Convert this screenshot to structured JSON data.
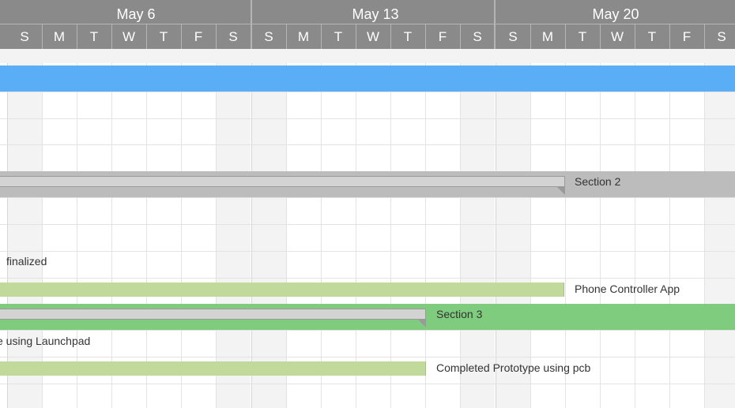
{
  "timeline": {
    "weeks": [
      {
        "label": "May 6"
      },
      {
        "label": "May 13"
      },
      {
        "label": "May 20"
      }
    ],
    "days": [
      "S",
      "M",
      "T",
      "W",
      "T",
      "F",
      "S",
      "S",
      "M",
      "T",
      "W",
      "T",
      "F",
      "S",
      "S",
      "M",
      "T",
      "W",
      "T",
      "F",
      "S"
    ]
  },
  "rows": {
    "section2": {
      "label": "Section 2"
    },
    "section3": {
      "label": "Section 3"
    },
    "task_finalized": {
      "label": "finalized"
    },
    "task_phone_controller": {
      "label": "Phone Controller App"
    },
    "task_launchpad": {
      "label": "e using Launchpad"
    },
    "task_pcb": {
      "label": "Completed Prototype using pcb"
    }
  },
  "colors": {
    "header_bg": "#8a8a8a",
    "section1_bar": "#5aaef5",
    "section2_bar": "#bcbcbc",
    "section3_bar": "#7fcc7f",
    "task_bar": "#c2d99c"
  }
}
